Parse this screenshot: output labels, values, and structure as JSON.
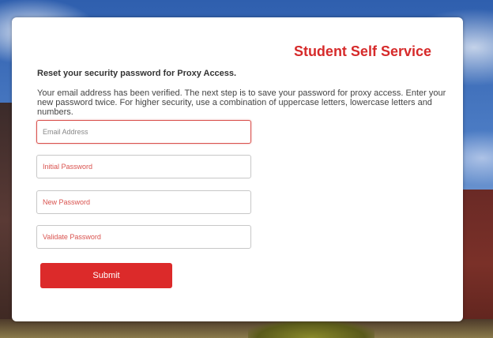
{
  "title": "Student Self Service",
  "heading": "Reset your security password for Proxy Access.",
  "description": "Your email address has been verified. The next step is to save your password for proxy access. Enter your new password twice. For higher security, use a combination of uppercase letters, lowercase letters and numbers.",
  "fields": {
    "email": {
      "placeholder": "Email Address",
      "value": ""
    },
    "initial_password": {
      "placeholder": "Initial Password",
      "value": ""
    },
    "new_password": {
      "placeholder": "New Password",
      "value": ""
    },
    "validate_password": {
      "placeholder": "Validate Password",
      "value": ""
    }
  },
  "submit_label": "Submit",
  "colors": {
    "accent": "#dc2a2a",
    "title": "#d62a2a",
    "placeholder": "#d9534f"
  }
}
